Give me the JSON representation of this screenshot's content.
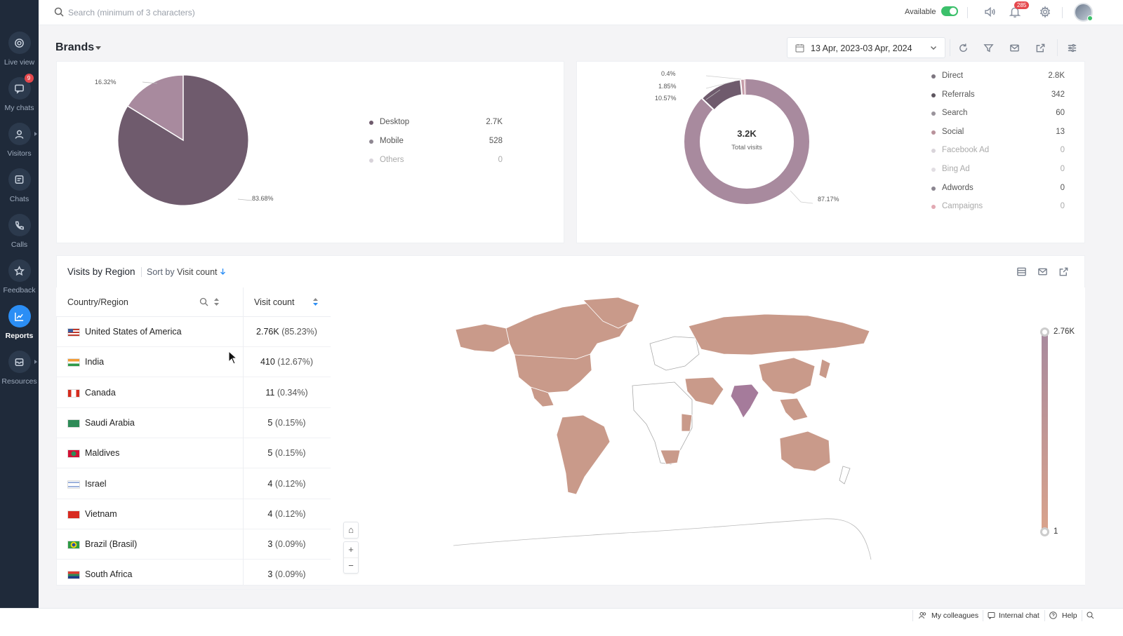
{
  "sidebar": {
    "items": [
      {
        "label": "Live view",
        "icon": "live-view-icon"
      },
      {
        "label": "My chats",
        "icon": "chat-bubble-icon",
        "badge": "9"
      },
      {
        "label": "Visitors",
        "icon": "user-icon"
      },
      {
        "label": "Chats",
        "icon": "chats-icon"
      },
      {
        "label": "Calls",
        "icon": "phone-icon"
      },
      {
        "label": "Feedback",
        "icon": "star-icon"
      },
      {
        "label": "Reports",
        "icon": "chart-trend-icon",
        "active": true
      },
      {
        "label": "Resources",
        "icon": "inbox-icon"
      }
    ]
  },
  "topbar": {
    "search_placeholder": "Search (minimum of 3 characters)",
    "availability_label": "Available",
    "notification_count": "285"
  },
  "header": {
    "title": "Brands",
    "date_range": "13 Apr, 2023-03 Apr, 2024"
  },
  "device_card": {
    "slice_labels": [
      "16.32%",
      "83.68%"
    ],
    "legend": [
      {
        "label": "Desktop",
        "value": "2.7K",
        "color": "#6f5b6d"
      },
      {
        "label": "Mobile",
        "value": "528",
        "color": "#8e8691"
      },
      {
        "label": "Others",
        "value": "0",
        "color": "#c8c2ca"
      }
    ]
  },
  "source_card": {
    "center_value": "3.2K",
    "center_label": "Total visits",
    "slice_labels": [
      "0.4%",
      "1.85%",
      "10.57%",
      "87.17%"
    ],
    "legend": [
      {
        "label": "Direct",
        "value": "2.8K",
        "color": "#7d7680"
      },
      {
        "label": "Referrals",
        "value": "342",
        "color": "#5e5660"
      },
      {
        "label": "Search",
        "value": "60",
        "color": "#9a949c"
      },
      {
        "label": "Social",
        "value": "13",
        "color": "#b9929b"
      },
      {
        "label": "Facebook Ad",
        "value": "0",
        "color": "#d9d4da"
      },
      {
        "label": "Bing Ad",
        "value": "0",
        "color": "#e2dee3"
      },
      {
        "label": "Adwords",
        "value": "0",
        "color": "#8b8590"
      },
      {
        "label": "Campaigns",
        "value": "0",
        "color": "#e2a9b3"
      }
    ]
  },
  "region": {
    "title": "Visits by Region",
    "sort_label": "Sort by",
    "sort_value": "Visit count",
    "col_country": "Country/Region",
    "col_count": "Visit count",
    "rows": [
      {
        "country": "United States of America",
        "count": "2.76K",
        "pct": "(85.23%)",
        "flag": "us"
      },
      {
        "country": "India",
        "count": "410",
        "pct": "(12.67%)",
        "flag": "in"
      },
      {
        "country": "Canada",
        "count": "11",
        "pct": "(0.34%)",
        "flag": "ca"
      },
      {
        "country": "Saudi Arabia",
        "count": "5",
        "pct": "(0.15%)",
        "flag": "sa"
      },
      {
        "country": "Maldives",
        "count": "5",
        "pct": "(0.15%)",
        "flag": "mv"
      },
      {
        "country": "Israel",
        "count": "4",
        "pct": "(0.12%)",
        "flag": "il"
      },
      {
        "country": "Vietnam",
        "count": "4",
        "pct": "(0.12%)",
        "flag": "vn"
      },
      {
        "country": "Brazil (Brasil)",
        "count": "3",
        "pct": "(0.09%)",
        "flag": "br"
      },
      {
        "country": "South Africa",
        "count": "3",
        "pct": "(0.09%)",
        "flag": "za"
      }
    ],
    "scale_max": "2.76K",
    "scale_min": "1"
  },
  "footer": {
    "colleagues": "My colleagues",
    "internal_chat": "Internal chat",
    "help": "Help"
  },
  "colors": {
    "accent": "#2b8ef5",
    "sidebar_bg": "#1f2a3a",
    "pie_main": "#6f5b6d",
    "pie_light": "#a88a9e",
    "map_fill": "#c99a8a",
    "map_high": "#a57b9b"
  }
}
